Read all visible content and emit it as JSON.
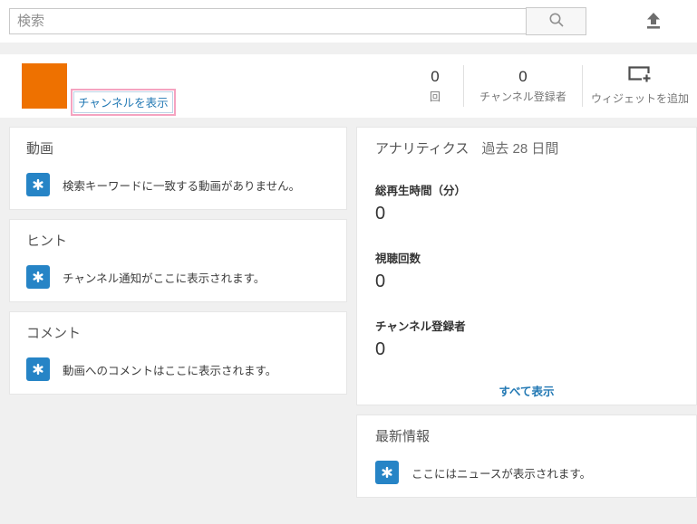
{
  "topbar": {
    "search_placeholder": "検索"
  },
  "header": {
    "channel_link_label": "チャンネルを表示",
    "stats": [
      {
        "value": "0",
        "label": "回"
      },
      {
        "value": "0",
        "label": "チャンネル登録者"
      }
    ],
    "add_widget_label": "ウィジェットを追加"
  },
  "cards": {
    "videos": {
      "title": "動画",
      "message": "検索キーワードに一致する動画がありません。"
    },
    "tips": {
      "title": "ヒント",
      "message": "チャンネル通知がここに表示されます。"
    },
    "comments": {
      "title": "コメント",
      "message": "動画へのコメントはここに表示されます。"
    }
  },
  "analytics": {
    "title": "アナリティクス",
    "period": "過去 28 日間",
    "metrics": [
      {
        "label": "総再生時間（分）",
        "value": "0"
      },
      {
        "label": "視聴回数",
        "value": "0"
      },
      {
        "label": "チャンネル登録者",
        "value": "0"
      }
    ],
    "view_all_label": "すべて表示"
  },
  "news": {
    "title": "最新情報",
    "message": "ここにはニュースが表示されます。"
  },
  "icons": {
    "search_button": "magnifier-icon",
    "upload": "upload-icon",
    "add_widget": "add-widget-icon",
    "card_bullet": "star-icon"
  },
  "colors": {
    "avatar_orange": "#ee7100",
    "star_blue": "#2684c6",
    "link_blue": "#2379b4",
    "highlight_pink": "#f5a3c0",
    "page_background": "#f0f0f0"
  }
}
